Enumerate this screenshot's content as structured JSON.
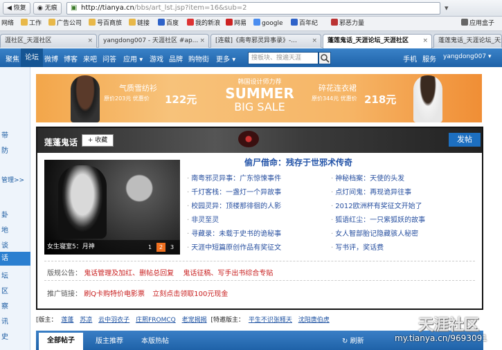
{
  "browser": {
    "back_label": "恢复",
    "trace_label": "无痕",
    "url_host": "http://tianya.cn",
    "url_path": "/bbs/art_lst.jsp?item=16&sub=2",
    "bookmarks": [
      "网络",
      "工作",
      "广告公司",
      "号百商旅",
      "链接",
      "百度",
      "我的新浪",
      "网易",
      "google",
      "百年纪",
      "邪恶力量",
      "应用盒子"
    ],
    "tabs": [
      {
        "label": "涯社区_天涯社区"
      },
      {
        "label": "yangdong007 - 天涯社区 #ap..."
      },
      {
        "label": "[连载]《南粤邪灵异事录》-..."
      },
      {
        "label": "蓬莲鬼话_天涯论坛_天涯社区",
        "active": true
      },
      {
        "label": "蓬莲鬼话_天涯论坛_天涯社区"
      }
    ]
  },
  "site_nav": {
    "items": [
      "聚焦",
      "论坛",
      "微博",
      "博客",
      "来吧",
      "问答",
      "应用",
      "游戏",
      "品牌",
      "购物街",
      "更多"
    ],
    "current": "论坛",
    "search_placeholder": "搜板块、搜遍天涯",
    "right": [
      "手机",
      "服务",
      "yangdong007"
    ]
  },
  "left_menu": [
    "带",
    "防",
    "管理>>",
    "卦",
    "地",
    "谈",
    "话",
    "坛",
    "区",
    "察",
    "讯",
    "史"
  ],
  "left_menu_selected": "话",
  "banner": {
    "left_title": "气质雪纺衫",
    "left_prices": "原价203元 优惠价",
    "left_price": "122元",
    "center_top": "韩国设计师力荐",
    "center_main": "SUMMER",
    "center_sub": "BIG SALE",
    "right_title": "碎花连衣裙",
    "right_prices": "原价344元 优惠价",
    "right_price": "218元"
  },
  "board": {
    "name": "莲蓬鬼话",
    "fav_label": "+ 收藏",
    "post_label": "发帖",
    "feature_title": "偷尸借命：残存于世邪术传奇",
    "feature_caption": "女生寝室5：月神",
    "pages": [
      "1",
      "2",
      "3"
    ],
    "links_left": [
      "南粤邪灵异事：广东惊悚事件",
      "千灯客栈：一盏灯一个异故事",
      "校园灵异：顶楼那徘徊的人影",
      "非灵至灵",
      "寻藏录：未载于史书的诡秘事",
      "天涯中短篇原创作品有奖征文"
    ],
    "links_right": [
      "神秘档案：天使的头发",
      "点灯间鬼：再现诡异往事",
      "2012欧洲杯有奖征文开始了",
      "狐语红尘：一只紫狐妖的故事",
      "女人智部胎记隐藏骇人秘密",
      "写书评，奖话费"
    ],
    "notice_label": "版规公告：",
    "notice_links": [
      "鬼话管理及加红、删帖总回复",
      "鬼话征稿、写手出书综合专贴"
    ],
    "promo_label": "推广链接：",
    "promo_links": [
      "刷Q卡购特价电影票",
      "立刻点击领取100元现金"
    ]
  },
  "moderators": {
    "label": "[版主：",
    "names": [
      "莲蓬",
      "苏凉",
      "云中羽衣子",
      "庄熙FROMCQ",
      "老宠揭揭"
    ],
    "special_label": "[特邀版主：",
    "special": [
      "平生不识张释天",
      "沈阳唐伯虎"
    ]
  },
  "bottom_tabs": [
    "全部帖子",
    "版主推荐",
    "本版热帖"
  ],
  "refresh_label": "刷新",
  "watermark": {
    "brand": "天涯社区",
    "url": "my.tianya.cn/9693091"
  }
}
